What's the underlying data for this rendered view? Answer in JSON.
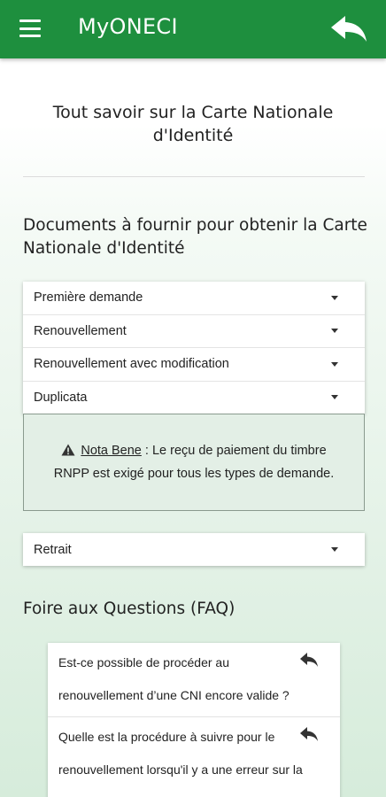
{
  "appbar": {
    "title": "MyONECI",
    "menu_icon": "hamburger-menu-icon",
    "back_icon": "reply-arrow-icon",
    "color": "#1e8f3e"
  },
  "page": {
    "title": "Tout savoir sur la Carte Nationale d'Identité"
  },
  "documents": {
    "title": "Documents à fournir pour obtenir la Carte Nationale d'Identité",
    "items": [
      {
        "label": "Première demande"
      },
      {
        "label": "Renouvellement"
      },
      {
        "label": "Renouvellement avec modification"
      },
      {
        "label": "Duplicata"
      }
    ],
    "nota": {
      "icon": "warning-icon",
      "label": "Nota Bene",
      "separator": " : ",
      "text": "Le reçu de paiement du timbre RNPP est exigé pour tous les types de demande."
    },
    "retrait": {
      "label": "Retrait"
    }
  },
  "faq": {
    "title": "Foire aux Questions (FAQ)",
    "items": [
      {
        "question": "Est-ce possible de procéder au renouvellement d’une CNI encore valide ?"
      },
      {
        "question": "Quelle est la procédure à suivre pour le renouvellement lorsqu'il y a une erreur sur la CNI (nom, date de naissance,"
      }
    ]
  }
}
